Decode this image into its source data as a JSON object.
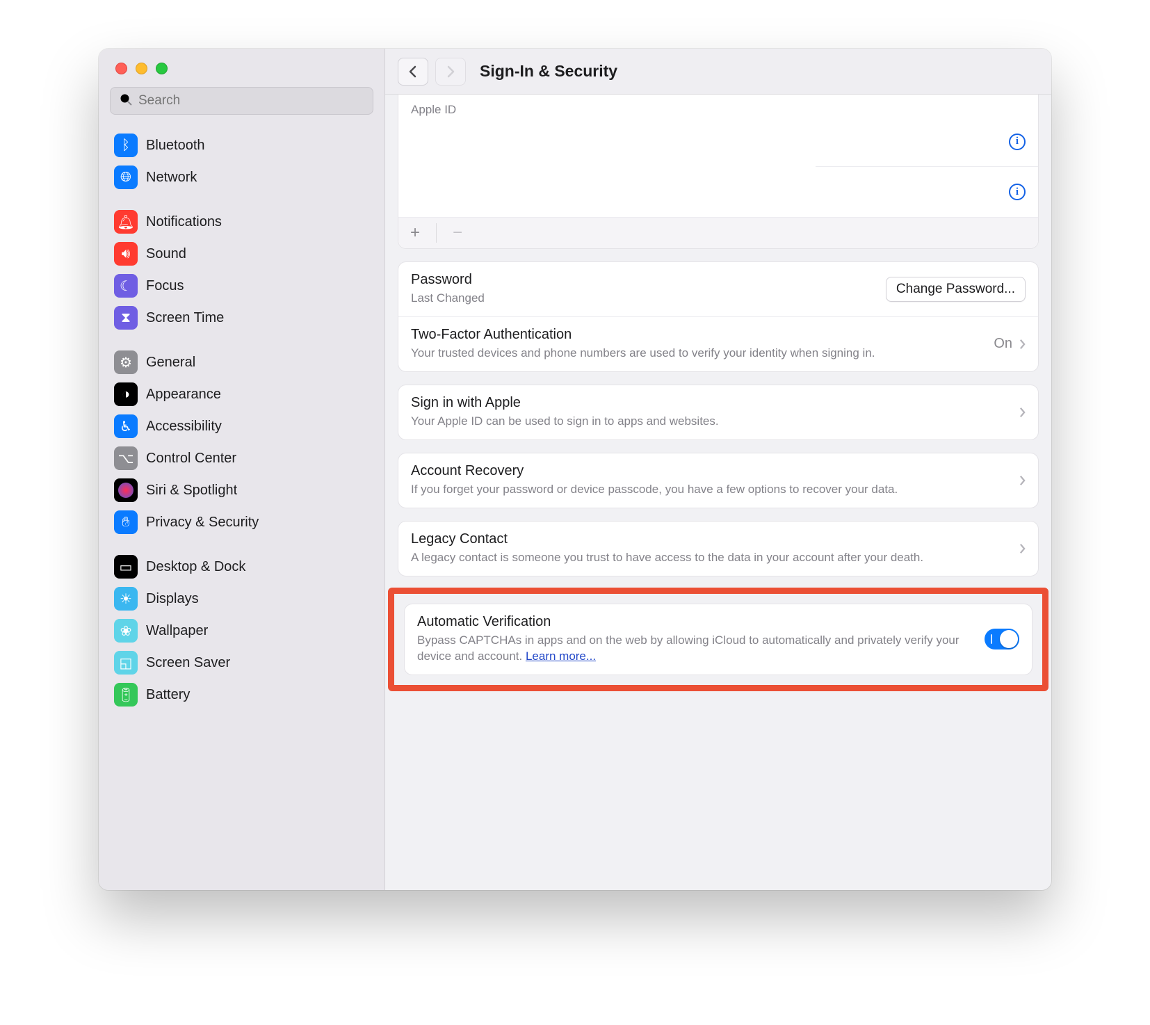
{
  "window": {
    "title": "Sign-In & Security",
    "search_placeholder": "Search"
  },
  "sidebar": {
    "items": [
      {
        "label": "Bluetooth"
      },
      {
        "label": "Network"
      },
      {
        "label": "Notifications"
      },
      {
        "label": "Sound"
      },
      {
        "label": "Focus"
      },
      {
        "label": "Screen Time"
      },
      {
        "label": "General"
      },
      {
        "label": "Appearance"
      },
      {
        "label": "Accessibility"
      },
      {
        "label": "Control Center"
      },
      {
        "label": "Siri & Spotlight"
      },
      {
        "label": "Privacy & Security"
      },
      {
        "label": "Desktop & Dock"
      },
      {
        "label": "Displays"
      },
      {
        "label": "Wallpaper"
      },
      {
        "label": "Screen Saver"
      },
      {
        "label": "Battery"
      }
    ]
  },
  "appleid": {
    "label": "Apple ID",
    "add_label": "+",
    "remove_label": "−"
  },
  "password": {
    "title": "Password",
    "subtitle": "Last Changed",
    "button": "Change Password..."
  },
  "twofactor": {
    "title": "Two-Factor Authentication",
    "description": "Your trusted devices and phone numbers are used to verify your identity when signing in.",
    "status": "On"
  },
  "signin": {
    "title": "Sign in with Apple",
    "description": "Your Apple ID can be used to sign in to apps and websites."
  },
  "recovery": {
    "title": "Account Recovery",
    "description": "If you forget your password or device passcode, you have a few options to recover your data."
  },
  "legacy": {
    "title": "Legacy Contact",
    "description": "A legacy contact is someone you trust to have access to the data in your account after your death."
  },
  "autoverify": {
    "title": "Automatic Verification",
    "description": "Bypass CAPTCHAs in apps and on the web by allowing iCloud to automatically and privately verify your device and account. ",
    "learn_more": "Learn more...",
    "enabled": true
  }
}
